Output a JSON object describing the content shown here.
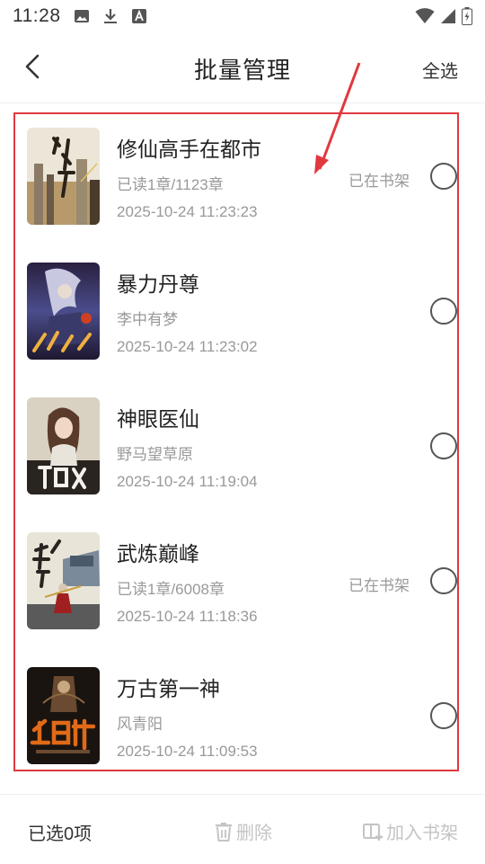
{
  "status_bar": {
    "time": "11:28",
    "icons": [
      "image-icon",
      "download-icon",
      "font-icon",
      "wifi-icon",
      "signal-icon",
      "battery-charging-icon"
    ]
  },
  "header": {
    "title": "批量管理",
    "select_all": "全选"
  },
  "books": [
    {
      "title": "修仙高手在都市",
      "subtitle": "已读1章/1123章",
      "time": "2025-10-24 11:23:23",
      "shelf": "已在书架",
      "cover_colors": [
        "#ece6d8",
        "#b89a6a",
        "#4a3b2a"
      ]
    },
    {
      "title": "暴力丹尊",
      "subtitle": "李中有梦",
      "time": "2025-10-24 11:23:02",
      "shelf": "",
      "cover_colors": [
        "#4a4d8c",
        "#9a9ac8",
        "#2a2040"
      ]
    },
    {
      "title": "神眼医仙",
      "subtitle": "野马望草原",
      "time": "2025-10-24 11:19:04",
      "shelf": "",
      "cover_colors": [
        "#d9d2c2",
        "#8a6a50",
        "#2a2420"
      ]
    },
    {
      "title": "武炼巅峰",
      "subtitle": "已读1章/6008章",
      "time": "2025-10-24 11:18:36",
      "shelf": "已在书架",
      "cover_colors": [
        "#e8e4d8",
        "#7a8a9a",
        "#3a3a3a"
      ]
    },
    {
      "title": "万古第一神",
      "subtitle": "风青阳",
      "time": "2025-10-24 11:09:53",
      "shelf": "",
      "cover_colors": [
        "#1a1410",
        "#c06a20",
        "#6a4a30"
      ]
    }
  ],
  "bottom_bar": {
    "selected_count": "已选0项",
    "delete_label": "删除",
    "add_label": "加入书架",
    "disabled_color": "#c4c4c4"
  },
  "annotation_color": "#e0393e"
}
